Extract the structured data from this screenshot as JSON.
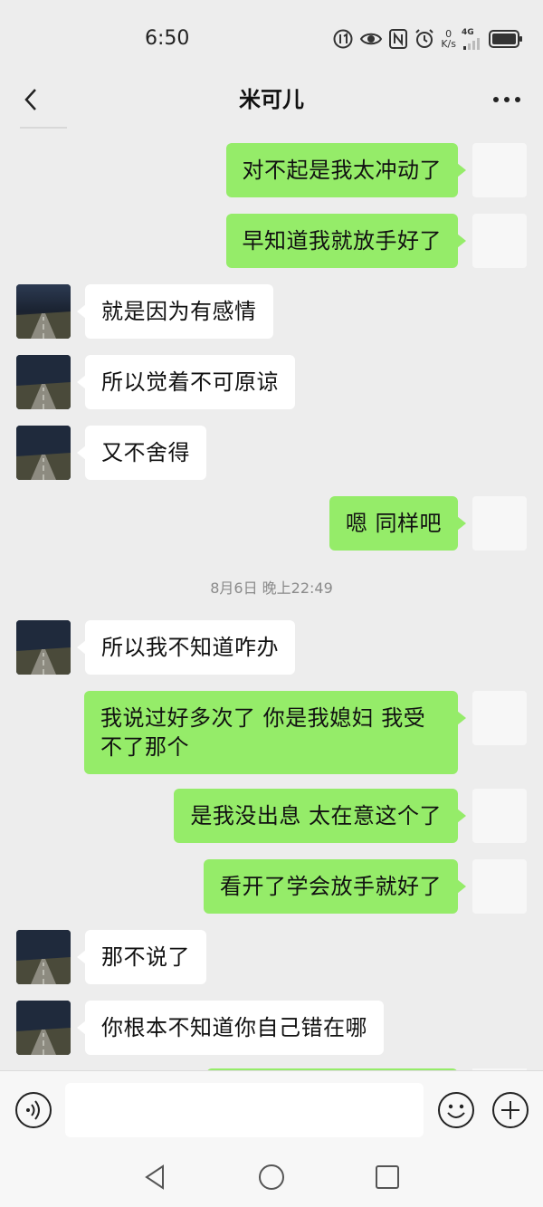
{
  "status_bar": {
    "time": "6:50",
    "net_speed_value": "0",
    "net_speed_unit": "K/s",
    "network_type": "4G",
    "icons": [
      "data-saver-icon",
      "eye-icon",
      "nfc-icon",
      "alarm-icon",
      "network-speed",
      "signal-icon",
      "battery-icon"
    ]
  },
  "header": {
    "title": "米可儿",
    "back_icon": "chevron-left-icon",
    "more_icon": "more-dots-icon"
  },
  "messages": [
    {
      "side": "out",
      "text": "对不起是我太冲动了"
    },
    {
      "side": "out",
      "text": "早知道我就放手好了"
    },
    {
      "side": "in",
      "text": "就是因为有感情"
    },
    {
      "side": "in",
      "text": "所以觉着不可原谅"
    },
    {
      "side": "in",
      "text": "又不舍得"
    },
    {
      "side": "out",
      "text": "嗯 同样吧"
    },
    {
      "timestamp": "8月6日 晚上22:49"
    },
    {
      "side": "in",
      "text": "所以我不知道咋办"
    },
    {
      "side": "out",
      "text": "我说过好多次了 你是我媳妇 我受不了那个"
    },
    {
      "side": "out",
      "text": "是我没出息 太在意这个了"
    },
    {
      "side": "out",
      "text": "看开了学会放手就好了"
    },
    {
      "side": "in",
      "text": "那不说了"
    },
    {
      "side": "in",
      "text": "你根本不知道你自己错在哪"
    }
  ],
  "input_bar": {
    "voice_icon": "voice-icon",
    "text_value": "",
    "emoji_icon": "emoji-icon",
    "plus_icon": "plus-icon"
  },
  "nav_bar": {
    "icons": [
      "nav-back-icon",
      "nav-home-icon",
      "nav-recent-icon"
    ]
  },
  "colors": {
    "background": "#ededed",
    "outgoing_bubble": "#95ec69",
    "incoming_bubble": "#ffffff",
    "timestamp_text": "#8a8a8a"
  }
}
